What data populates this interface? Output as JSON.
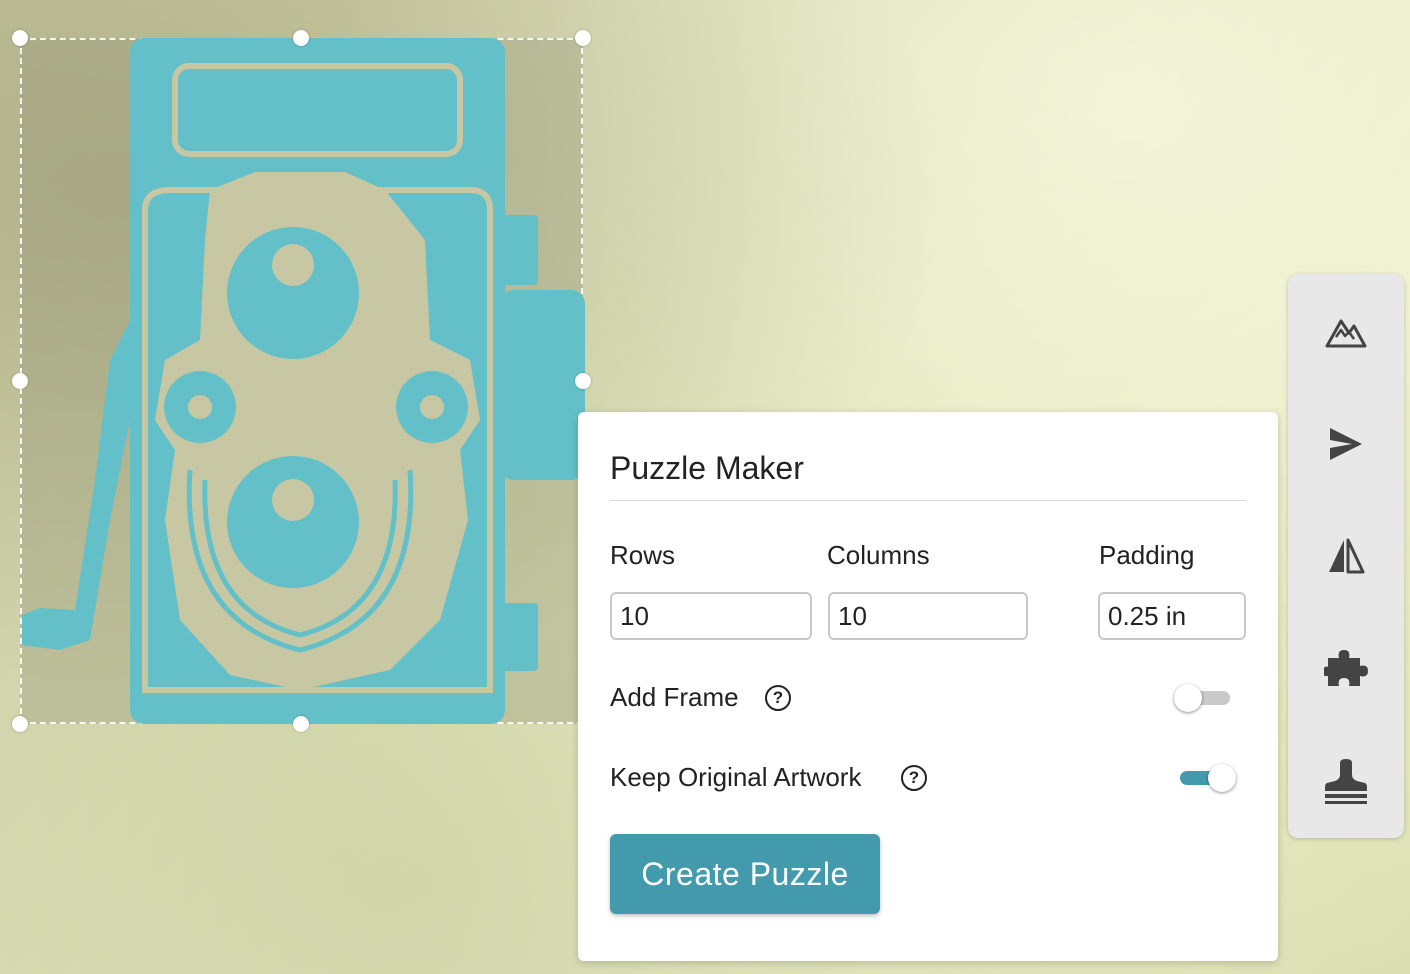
{
  "canvas": {
    "artwork_name": "camera-artwork",
    "artwork_color": "#63c0c8",
    "artwork_accent": "#c8c7a4"
  },
  "panel": {
    "title": "Puzzle Maker",
    "rows_label": "Rows",
    "rows_value": "10",
    "columns_label": "Columns",
    "columns_value": "10",
    "padding_label": "Padding",
    "padding_value": "0.25 in",
    "add_frame_label": "Add Frame",
    "add_frame_on": false,
    "keep_artwork_label": "Keep Original Artwork",
    "keep_artwork_on": true,
    "help_glyph": "?",
    "create_label": "Create Puzzle",
    "accent": "#449aad"
  },
  "toolbar": {
    "tools": [
      "mountain-icon",
      "send-icon",
      "mirror-icon",
      "puzzle-icon",
      "stamp-icon"
    ]
  }
}
